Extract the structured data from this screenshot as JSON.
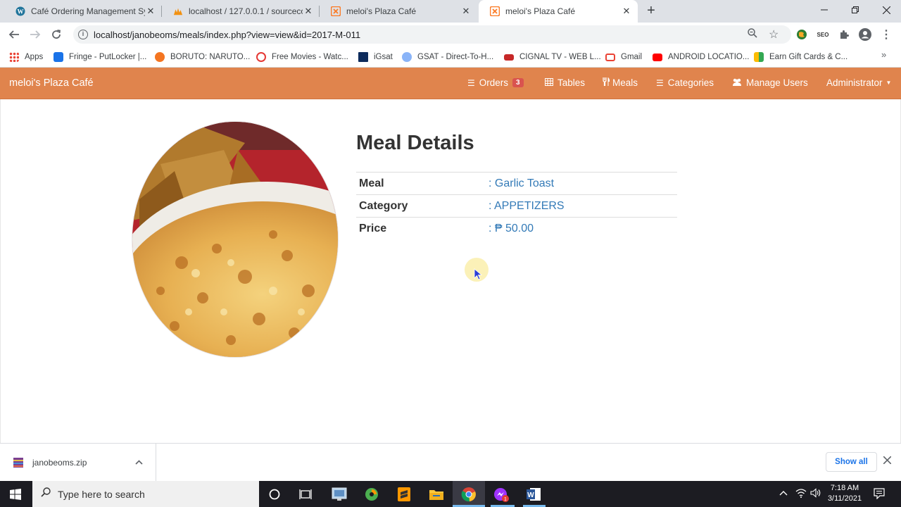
{
  "browser": {
    "tabs": [
      {
        "title": "Café Ordering Management Syst",
        "icon": "wordpress-icon",
        "active": false
      },
      {
        "title": "localhost / 127.0.0.1 / sourcecod",
        "icon": "phpmyadmin-icon",
        "active": false
      },
      {
        "title": "meloi's Plaza Café",
        "icon": "xampp-icon",
        "active": false
      },
      {
        "title": "meloi's Plaza Café",
        "icon": "xampp-icon",
        "active": true
      }
    ],
    "url": "localhost/janobeoms/meals/index.php?view=view&id=2017-M-011",
    "bookmarks": [
      {
        "label": "Apps",
        "icon": "apps-grid-icon"
      },
      {
        "label": "Fringe - PutLocker |...",
        "icon": "putlocker-icon"
      },
      {
        "label": "BORUTO: NARUTO...",
        "icon": "crunchyroll-icon"
      },
      {
        "label": "Free Movies - Watc...",
        "icon": "play-icon"
      },
      {
        "label": "iGsat",
        "icon": "igsat-icon"
      },
      {
        "label": "GSAT - Direct-To-H...",
        "icon": "gsat-icon"
      },
      {
        "label": "CIGNAL TV - WEB L...",
        "icon": "cignal-icon"
      },
      {
        "label": "Gmail",
        "icon": "gmail-icon"
      },
      {
        "label": "ANDROID LOCATIO...",
        "icon": "youtube-icon"
      },
      {
        "label": "Earn Gift Cards & C...",
        "icon": "giftcards-icon"
      }
    ]
  },
  "app": {
    "brand": "meloi's Plaza Café",
    "nav": {
      "orders": "Orders",
      "orders_badge": "3",
      "tables": "Tables",
      "meals": "Meals",
      "categories": "Categories",
      "manage_users": "Manage Users",
      "user_menu": "Administrator"
    },
    "colors": {
      "navbar": "#e0844d",
      "link": "#337ab7",
      "badge": "#d9534f"
    }
  },
  "page": {
    "heading": "Meal Details",
    "details": [
      {
        "label": "Meal",
        "value": ": Garlic Toast"
      },
      {
        "label": "Category",
        "value": ": APPETIZERS"
      },
      {
        "label": "Price",
        "value": ": ₱ 50.00"
      }
    ]
  },
  "downloads": {
    "file": "janobeoms.zip",
    "show_all": "Show all"
  },
  "taskbar": {
    "search_placeholder": "Type here to search",
    "time": "7:18 AM",
    "date": "3/11/2021"
  }
}
